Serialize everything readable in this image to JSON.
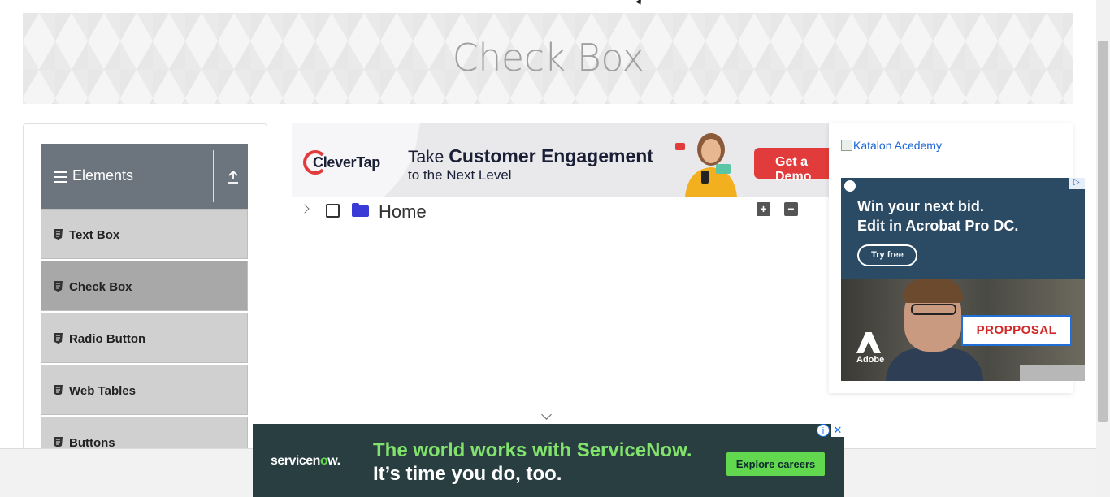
{
  "page": {
    "title": "Check Box"
  },
  "sidebar": {
    "group_title": "Elements",
    "items": [
      {
        "label": "Text Box",
        "active": false
      },
      {
        "label": "Check Box",
        "active": true
      },
      {
        "label": "Radio Button",
        "active": false
      },
      {
        "label": "Web Tables",
        "active": false
      },
      {
        "label": "Buttons",
        "active": false
      }
    ]
  },
  "tree": {
    "root_label": "Home",
    "expand_all_label": "+",
    "collapse_all_label": "−"
  },
  "ads": {
    "clevertap": {
      "logo": "CleverTap",
      "take": "Take",
      "headline_bold": "Customer Engagement",
      "subline": "to the Next Level",
      "cta": "Get a Demo"
    },
    "katalon": {
      "alt_text": "Katalon Acedemy"
    },
    "adobe": {
      "headline_1": "Win your next bid.",
      "headline_2": "Edit in Acrobat Pro DC.",
      "cta": "Try free",
      "proposal": "PROPPOSAL",
      "brand": "Adobe"
    },
    "servicenow": {
      "logo_main": "servicen",
      "logo_accent": "o",
      "logo_end": "w.",
      "line1": "The world works with ServiceNow.",
      "line2": "It’s time you do, too.",
      "cta": "Explore careers",
      "info": "i",
      "close": "✕"
    }
  },
  "colors": {
    "sidebar_header": "#6c757d",
    "menu_item_bg": "#d0d0d0",
    "menu_item_active_bg": "#a8a8a8",
    "folder": "#3a3ad6",
    "servicenow_green": "#62d84e"
  }
}
